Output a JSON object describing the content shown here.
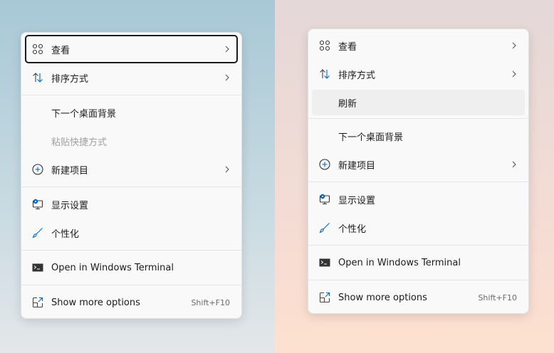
{
  "left_menu": {
    "items": [
      {
        "label": "查看",
        "icon": "grid-icon",
        "submenu": true
      },
      {
        "label": "排序方式",
        "icon": "sort-icon",
        "submenu": true
      },
      {
        "label": "下一个桌面背景"
      },
      {
        "label": "粘贴快捷方式",
        "disabled": true
      },
      {
        "label": "新建项目",
        "icon": "plus-circle-icon",
        "submenu": true
      },
      {
        "label": "显示设置",
        "icon": "display-settings-icon"
      },
      {
        "label": "个性化",
        "icon": "brush-icon"
      },
      {
        "label": "Open in Windows Terminal",
        "icon": "terminal-icon"
      },
      {
        "label": "Show more options",
        "icon": "expand-icon",
        "shortcut": "Shift+F10"
      }
    ]
  },
  "right_menu": {
    "items": [
      {
        "label": "查看",
        "icon": "grid-icon",
        "submenu": true
      },
      {
        "label": "排序方式",
        "icon": "sort-icon",
        "submenu": true
      },
      {
        "label": "刷新"
      },
      {
        "label": "下一个桌面背景"
      },
      {
        "label": "新建项目",
        "icon": "plus-circle-icon",
        "submenu": true
      },
      {
        "label": "显示设置",
        "icon": "display-settings-icon"
      },
      {
        "label": "个性化",
        "icon": "brush-icon"
      },
      {
        "label": "Open in Windows Terminal",
        "icon": "terminal-icon"
      },
      {
        "label": "Show more options",
        "icon": "expand-icon",
        "shortcut": "Shift+F10"
      }
    ]
  },
  "colors": {
    "accent": "#0067c0",
    "text": "#1b1b1b",
    "disabled": "#a0a0a0"
  }
}
